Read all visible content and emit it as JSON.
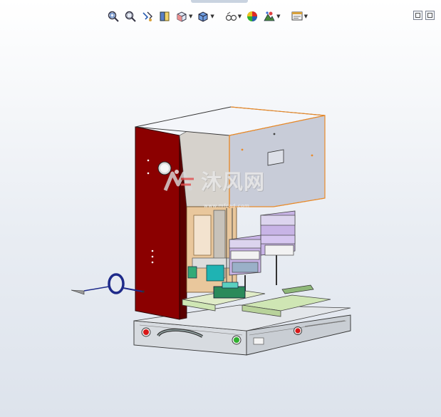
{
  "toolbar": {
    "tools": [
      {
        "name": "zoom-to-fit-icon"
      },
      {
        "name": "zoom-to-area-icon"
      },
      {
        "name": "previous-view-icon"
      },
      {
        "name": "section-view-icon"
      },
      {
        "name": "view-orientation-icon"
      },
      {
        "name": "display-style-icon"
      },
      {
        "name": "hide-show-items-icon"
      },
      {
        "name": "edit-appearance-icon"
      },
      {
        "name": "apply-scene-icon"
      },
      {
        "name": "view-settings-icon"
      }
    ]
  },
  "window_controls": [
    "tile-view-icon",
    "restore-view-icon"
  ],
  "watermark": {
    "text": "沐风网",
    "url": "www.mfcad.com"
  },
  "colors": {
    "side_panel": "#8b0000",
    "cover": "#c8ccd8",
    "cover_edge": "#e88a2a",
    "base_plate": "#d7dbe0",
    "cylinder": "#c8b4e6",
    "fixture_green": "#cfe6b4",
    "cable": "#1e2a8a",
    "red_button": "#d81818",
    "green_button": "#2fb02f"
  }
}
